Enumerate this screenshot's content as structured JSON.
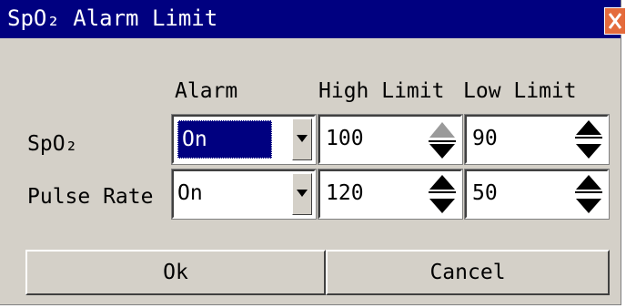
{
  "window": {
    "title": "SpO₂ Alarm Limit"
  },
  "columns": {
    "alarm": "Alarm",
    "high_limit": "High Limit",
    "low_limit": "Low Limit"
  },
  "rows": [
    {
      "label": "SpO₂",
      "alarm": "On",
      "high": "100",
      "low": "90"
    },
    {
      "label": "Pulse Rate",
      "alarm": "On",
      "high": "120",
      "low": "50"
    }
  ],
  "buttons": {
    "ok": "Ok",
    "cancel": "Cancel"
  },
  "colors": {
    "titlebar": "#000080",
    "dialog_bg": "#d4d0c8",
    "close_button": "#e46b3c",
    "selection": "#000080"
  },
  "icons": {
    "close": "close-icon",
    "dropdown": "chevron-down-icon",
    "spin_up": "arrow-up-icon",
    "spin_down": "arrow-down-icon"
  }
}
